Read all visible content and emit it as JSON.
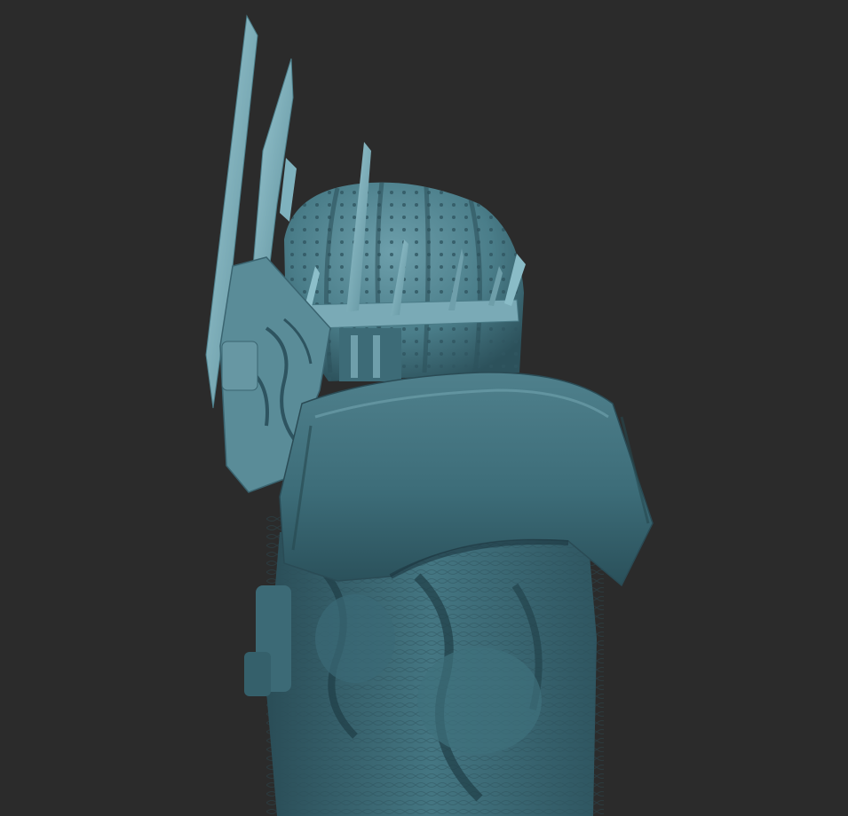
{
  "scene": {
    "subject": "sculpt-render",
    "background_color": "#2b2b2b",
    "material": {
      "base": "#3f6f7c",
      "light": "#6fa3b0",
      "highlight": "#8fc1cc",
      "shadow": "#22424b",
      "deep_shadow": "#17303a"
    }
  }
}
